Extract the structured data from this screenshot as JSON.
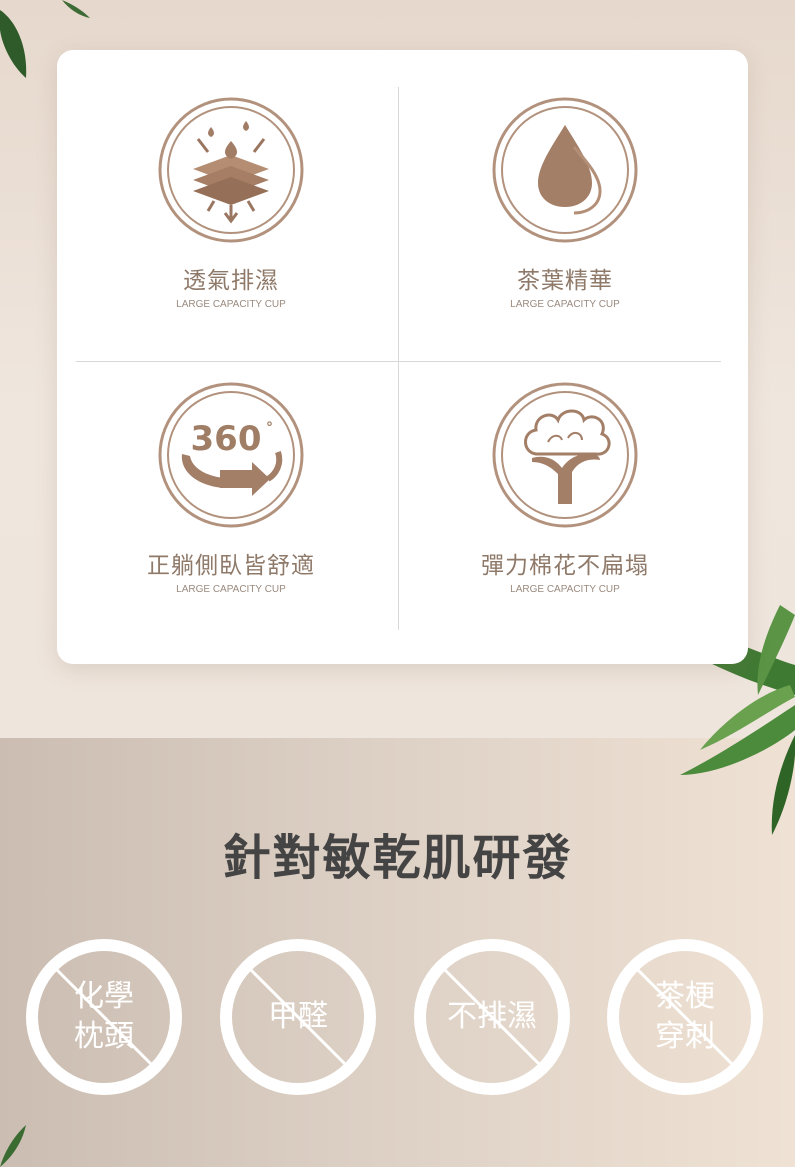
{
  "features": [
    {
      "icon": "breathable-layers-icon",
      "title": "透氣排濕",
      "subtitle": "LARGE CAPACITY CUP"
    },
    {
      "icon": "water-drop-icon",
      "title": "茶葉精華",
      "subtitle": "LARGE CAPACITY CUP"
    },
    {
      "icon": "rotate-360-icon",
      "icon_text": "360",
      "icon_degree": "°",
      "title": "正躺側臥皆舒適",
      "subtitle": "LARGE CAPACITY CUP"
    },
    {
      "icon": "cotton-flower-icon",
      "title": "彈力棉花不扁塌",
      "subtitle": "LARGE CAPACITY CUP"
    }
  ],
  "section_title": "針對敏乾肌研發",
  "prohibitions": [
    {
      "icon": "prohibited-icon",
      "text": "化學枕頭"
    },
    {
      "icon": "prohibited-icon",
      "text": "甲醛"
    },
    {
      "icon": "prohibited-icon",
      "text": "不排濕"
    },
    {
      "icon": "prohibited-icon",
      "text": "茶梗穿刺"
    }
  ],
  "colors": {
    "accent": "#a07e66",
    "icon_light": "#c2a08a",
    "title_text": "#444444",
    "feature_text": "#8f7a6a"
  }
}
